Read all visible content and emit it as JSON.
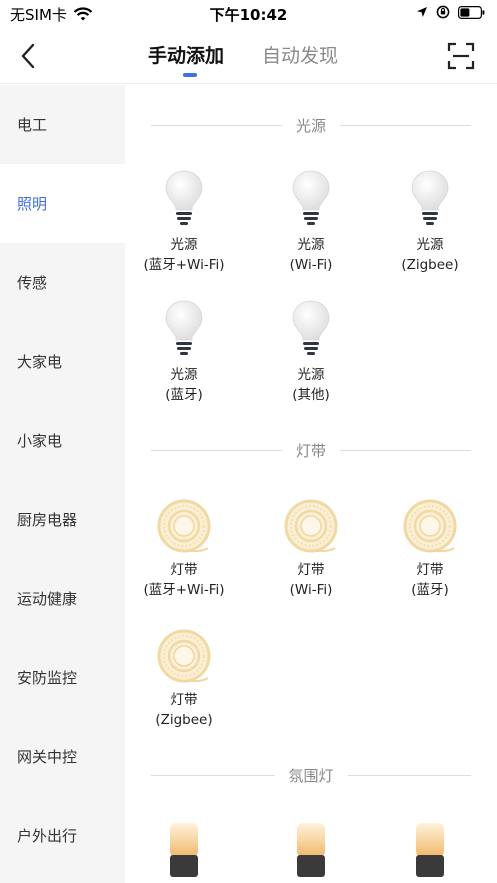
{
  "status": {
    "carrier": "无SIM卡",
    "time": "下午10:42"
  },
  "nav": {
    "tabs": [
      {
        "label": "手动添加"
      },
      {
        "label": "自动发现"
      }
    ]
  },
  "sidebar": {
    "items": [
      {
        "label": "电工"
      },
      {
        "label": "照明"
      },
      {
        "label": "传感"
      },
      {
        "label": "大家电"
      },
      {
        "label": "小家电"
      },
      {
        "label": "厨房电器"
      },
      {
        "label": "运动健康"
      },
      {
        "label": "安防监控"
      },
      {
        "label": "网关中控"
      },
      {
        "label": "户外出行"
      }
    ],
    "active_index": 1
  },
  "sections": [
    {
      "title": "光源",
      "devices": [
        {
          "line1": "光源",
          "line2": "(蓝牙+Wi-Fi)",
          "icon": "bulb-icon"
        },
        {
          "line1": "光源",
          "line2": "(Wi-Fi)",
          "icon": "bulb-icon"
        },
        {
          "line1": "光源",
          "line2": "(Zigbee)",
          "icon": "bulb-icon"
        },
        {
          "line1": "光源",
          "line2": "(蓝牙)",
          "icon": "bulb-icon"
        },
        {
          "line1": "光源",
          "line2": "(其他)",
          "icon": "bulb-icon"
        }
      ]
    },
    {
      "title": "灯带",
      "devices": [
        {
          "line1": "灯带",
          "line2": "(蓝牙+Wi-Fi)",
          "icon": "light-strip-icon"
        },
        {
          "line1": "灯带",
          "line2": "(Wi-Fi)",
          "icon": "light-strip-icon"
        },
        {
          "line1": "灯带",
          "line2": "(蓝牙)",
          "icon": "light-strip-icon"
        },
        {
          "line1": "灯带",
          "line2": "(Zigbee)",
          "icon": "light-strip-icon"
        }
      ]
    },
    {
      "title": "氛围灯",
      "devices": [
        {
          "icon": "ambient-lamp-icon"
        },
        {
          "icon": "ambient-lamp-icon"
        },
        {
          "icon": "ambient-lamp-icon"
        }
      ]
    }
  ],
  "colors": {
    "accent": "#3f6fe3",
    "sidebar_bg": "#f5f5f5"
  }
}
